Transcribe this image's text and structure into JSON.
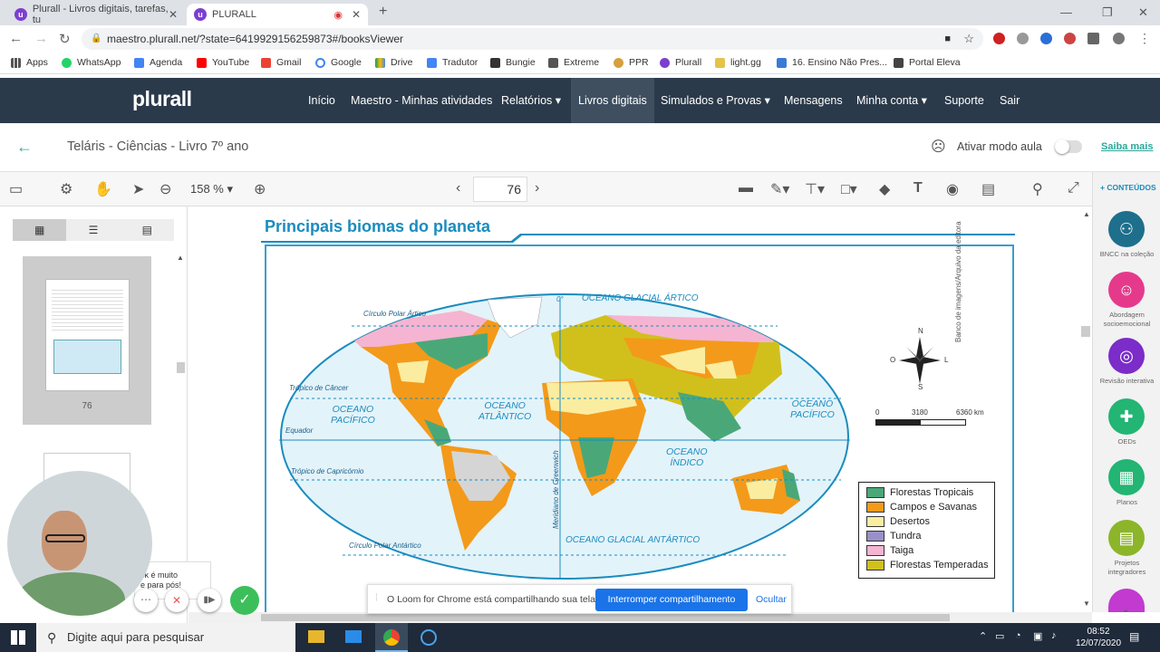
{
  "browser": {
    "tabs": [
      {
        "title": "Plurall - Livros digitais, tarefas, tu"
      },
      {
        "title": "PLURALL"
      }
    ],
    "url": "maestro.plurall.net/?state=6419929156259873#/booksViewer",
    "bookmarks": [
      "Apps",
      "WhatsApp",
      "Agenda",
      "YouTube",
      "Gmail",
      "Google",
      "Drive",
      "Tradutor",
      "Bungie",
      "Extreme",
      "PPR",
      "Plurall",
      "light.gg",
      "16. Ensino Não Pres...",
      "Portal Eleva"
    ]
  },
  "header": {
    "logo": "plurall",
    "nav": [
      "Início",
      "Maestro - Minhas atividades",
      "Relatórios",
      "Livros digitais",
      "Simulados e Provas",
      "Mensagens",
      "Minha conta",
      "Suporte",
      "Sair"
    ]
  },
  "subheader": {
    "book_title": "Teláris - Ciências - Livro 7º ano",
    "mode_label": "Ativar modo aula",
    "saiba": "Saiba mais"
  },
  "toolbar": {
    "zoom": "158 %",
    "page": "76"
  },
  "thumbs": {
    "page_label": "76"
  },
  "map": {
    "title": "Principais biomas do planeta",
    "credit": "Banco de imagens/Arquivo da editora",
    "labels": {
      "artico": "OCEANO GLACIAL ÁRTICO",
      "antartico": "OCEANO GLACIAL ANTÁRTICO",
      "pac1a": "OCEANO",
      "pac1b": "PACÍFICO",
      "pac2a": "OCEANO",
      "pac2b": "PACÍFICO",
      "atl_a": "OCEANO",
      "atl_b": "ATLÂNTICO",
      "ind_a": "OCEANO",
      "ind_b": "ÍNDICO",
      "polar_artico": "Círculo Polar Ártico",
      "cancer": "Trópico de Câncer",
      "equador": "Equador",
      "capricornio": "Trópico de Capricórnio",
      "polar_antartico": "Círculo Polar Antártico",
      "greenwich": "Meridiano de Greenwich",
      "zero": "0°"
    },
    "compass": {
      "n": "N",
      "s": "S",
      "l": "L",
      "o": "O"
    },
    "scale": [
      "0",
      "3180",
      "6360 km"
    ],
    "legend": [
      {
        "label": "Florestas Tropicais",
        "color": "#4aa878"
      },
      {
        "label": "Campos e Savanas",
        "color": "#f39a1a"
      },
      {
        "label": "Desertos",
        "color": "#fbeda0"
      },
      {
        "label": "Tundra",
        "color": "#9a90c8"
      },
      {
        "label": "Taiga",
        "color": "#f5b4d2"
      },
      {
        "label": "Florestas Temperadas",
        "color": "#d1c01c"
      }
    ]
  },
  "rightbar": {
    "top": "+ CONTEÚDOS",
    "items": [
      "BNCC na coleção",
      "Abordagem socioemocional",
      "Revisão interativa",
      "OEDs",
      "Planos",
      "Projetos integradores"
    ]
  },
  "loom": {
    "message": "O Loom for Chrome está compartilhando sua tela.",
    "stop": "Interromper compartilhamento",
    "hide": "Ocultar"
  },
  "webcam": {
    "bubble1": "ck é muito",
    "bubble2": "e para pós!"
  },
  "taskbar": {
    "search": "Digite aqui para pesquisar",
    "time": "08:52",
    "date": "12/07/2020"
  }
}
